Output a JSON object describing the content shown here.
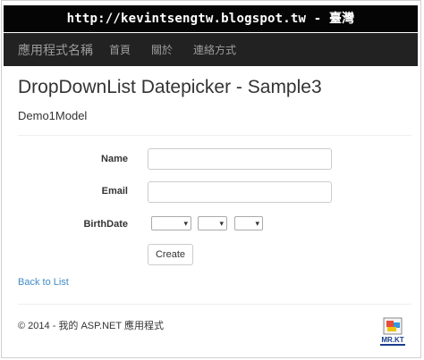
{
  "caption": "http://kevintsengtw.blogspot.tw - 臺灣",
  "navbar": {
    "brand": "應用程式名稱",
    "links": [
      "首頁",
      "關於",
      "連絡方式"
    ]
  },
  "page": {
    "title": "DropDownList Datepicker - Sample3",
    "subtitle": "Demo1Model"
  },
  "form": {
    "name_label": "Name",
    "email_label": "Email",
    "birthdate_label": "BirthDate",
    "name_value": "",
    "email_value": "",
    "selects": [
      {
        "selected": ""
      },
      {
        "selected": ""
      },
      {
        "selected": ""
      }
    ],
    "create_label": "Create"
  },
  "back_link": "Back to List",
  "footer": "© 2014 - 我的 ASP.NET 應用程式",
  "logo": {
    "text": "MR.KT"
  },
  "colors": {
    "navbar": "#222222",
    "link": "#428bca",
    "caption_bg": "#050505"
  }
}
